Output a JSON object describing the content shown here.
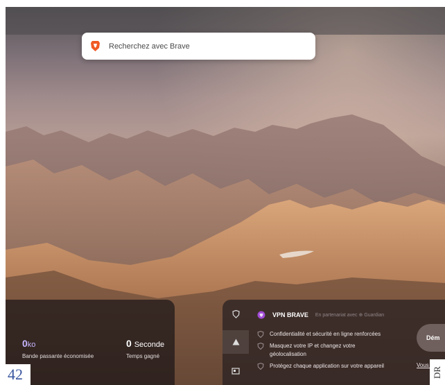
{
  "search": {
    "placeholder": "Recherchez avec Brave"
  },
  "stats": {
    "bandwidth": {
      "value": "0",
      "unit": "ko",
      "label": "Bande passante économisée"
    },
    "time": {
      "value": "0",
      "unit": "Seconde",
      "label": "Temps gagné"
    }
  },
  "vpn": {
    "title": "VPN BRAVE",
    "partner": "En partenariat avec",
    "partner_name": "Guardian",
    "features": [
      "Confidentialité et sécurité en ligne renforcées",
      "Masquez votre IP et changez votre géolocalisation",
      "Protégez chaque application sur votre appareil"
    ],
    "start_label": "Dém",
    "subscribed_label": "Vous abon"
  },
  "page": {
    "number": "42",
    "credit": "DR"
  },
  "colors": {
    "brave_orange": "#f05a24",
    "vpn_purple": "#a24bd6",
    "stat_purple": "#c7b6ff"
  },
  "icons": [
    "brave-lion-icon",
    "shield-icon",
    "warning-icon",
    "news-icon",
    "vpn-logo-icon",
    "check-bullet-icon"
  ]
}
